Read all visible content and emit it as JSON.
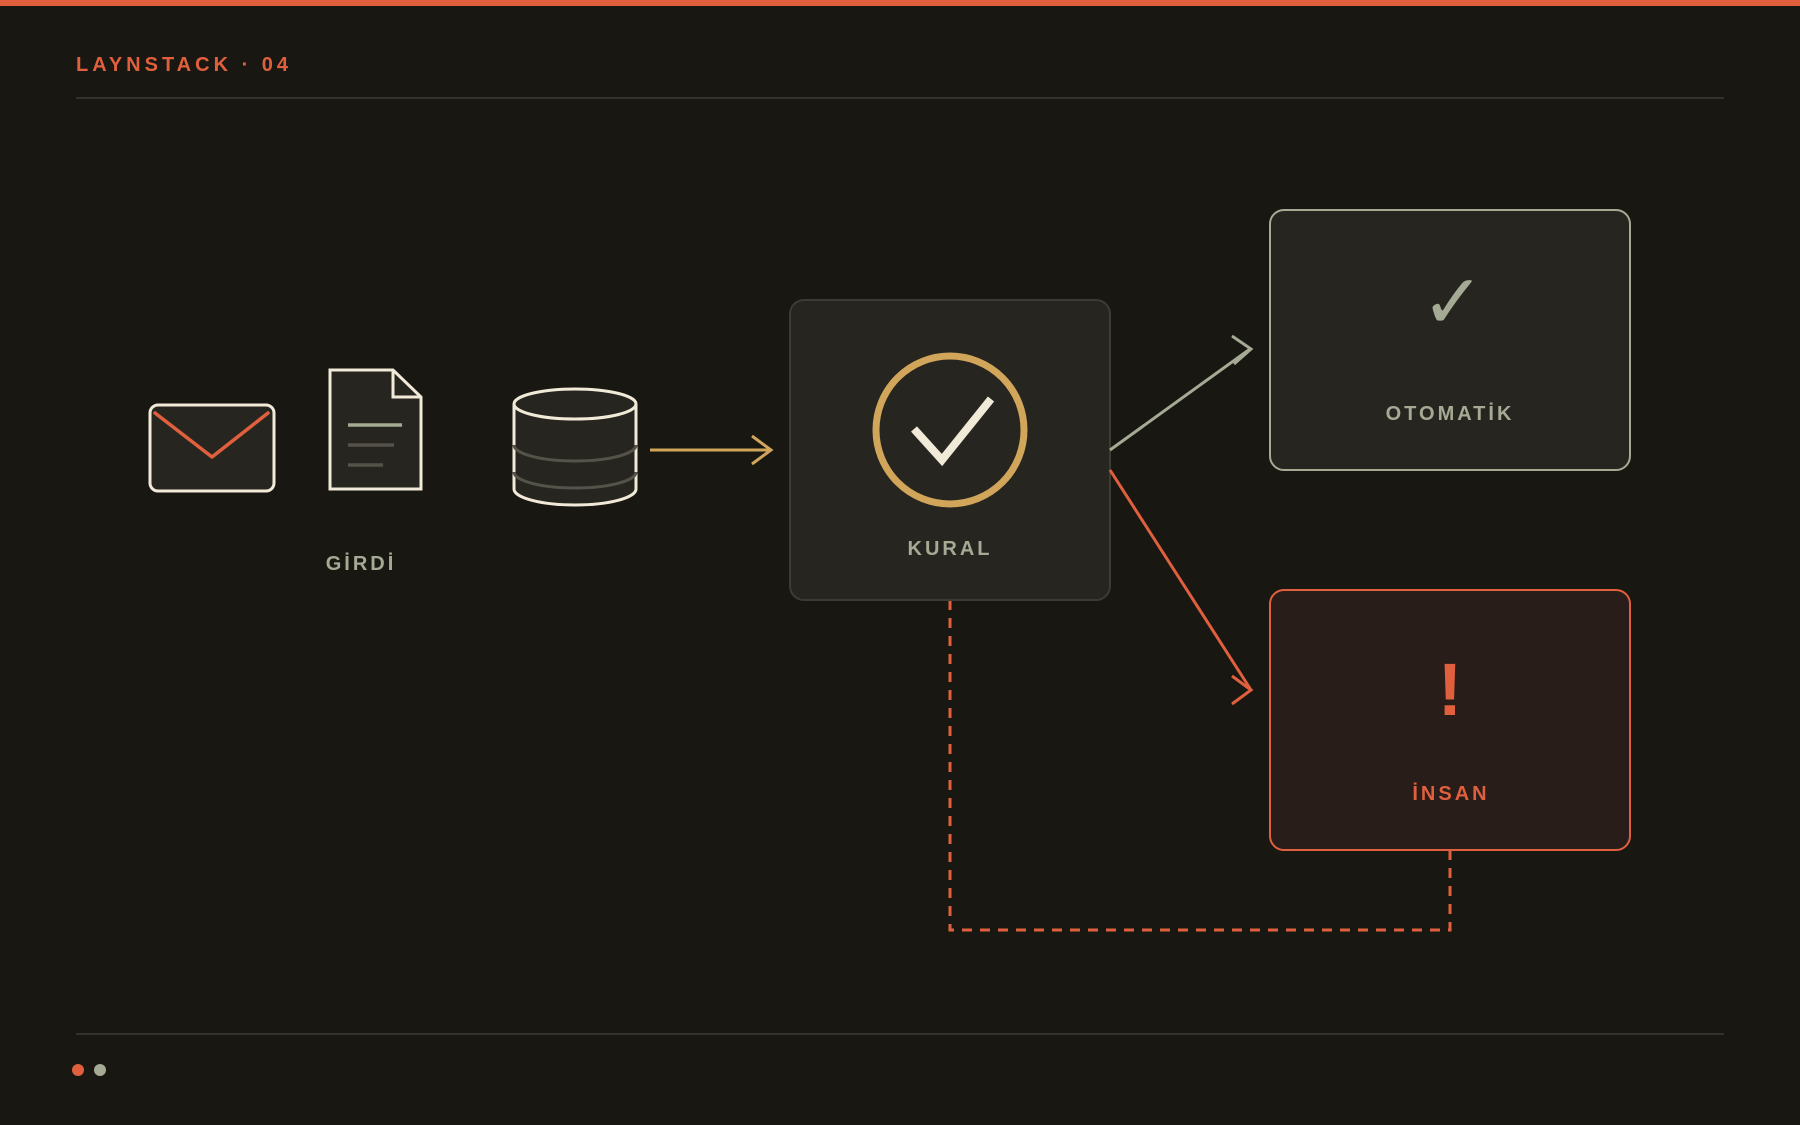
{
  "header": {
    "brand": "LAYNSTACK · 04"
  },
  "diagram": {
    "input_label": "GİRDİ",
    "rule_label": "KURAL",
    "auto_label": "OTOMATİK",
    "human_label": "İNSAN",
    "auto_glyph": "✓",
    "human_glyph": "!"
  },
  "icons": {
    "input_icons": [
      "envelope-icon",
      "document-icon",
      "database-icon"
    ],
    "rule_icon": "check-circle-icon"
  },
  "colors": {
    "background": "#181712",
    "accent": "#E0603D",
    "gold": "#D1A55A",
    "sage": "#A5AA94",
    "cream": "#F1EAD8",
    "panel": "#27251f",
    "human_panel": "#281d19"
  },
  "pager": {
    "pages": 2,
    "active_index": 0
  }
}
